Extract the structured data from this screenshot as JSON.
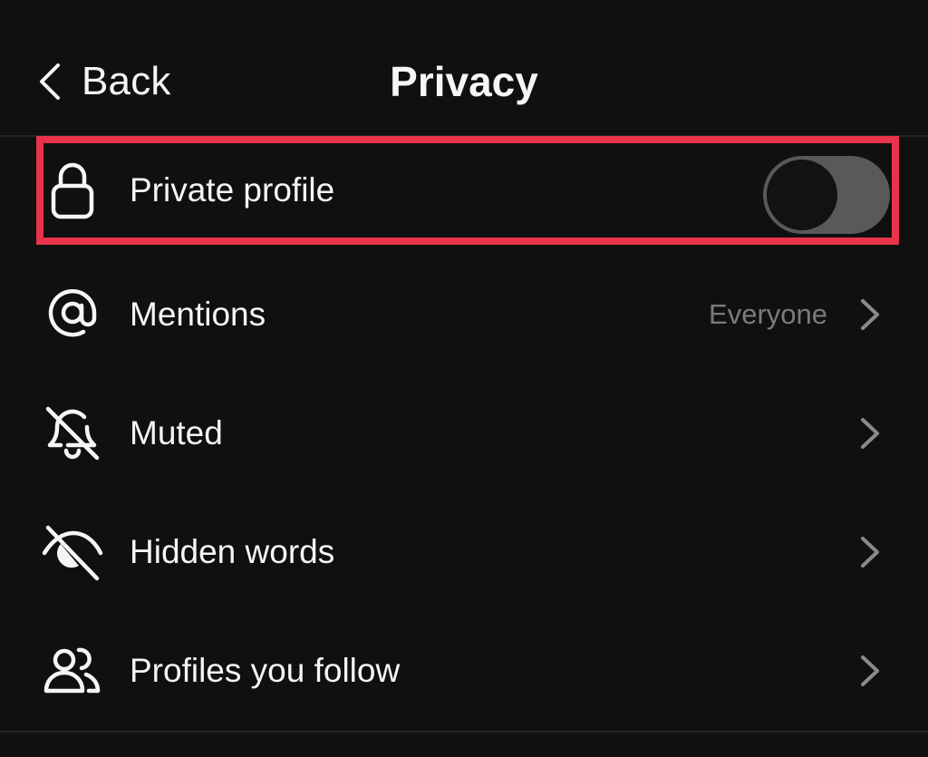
{
  "header": {
    "back_label": "Back",
    "title": "Privacy"
  },
  "rows": [
    {
      "label": "Private profile",
      "icon": "lock-icon",
      "control": "toggle",
      "toggle_on": false
    },
    {
      "label": "Mentions",
      "icon": "at-sign-icon",
      "value": "Everyone",
      "control": "chevron"
    },
    {
      "label": "Muted",
      "icon": "bell-off-icon",
      "control": "chevron"
    },
    {
      "label": "Hidden words",
      "icon": "eye-off-icon",
      "control": "chevron"
    },
    {
      "label": "Profiles you follow",
      "icon": "people-icon",
      "control": "chevron"
    }
  ],
  "colors": {
    "background": "#101010",
    "text": "#f5f5f5",
    "secondary_text": "#7b7b7b",
    "highlight": "#e8334a",
    "toggle_track_off": "#595959"
  }
}
